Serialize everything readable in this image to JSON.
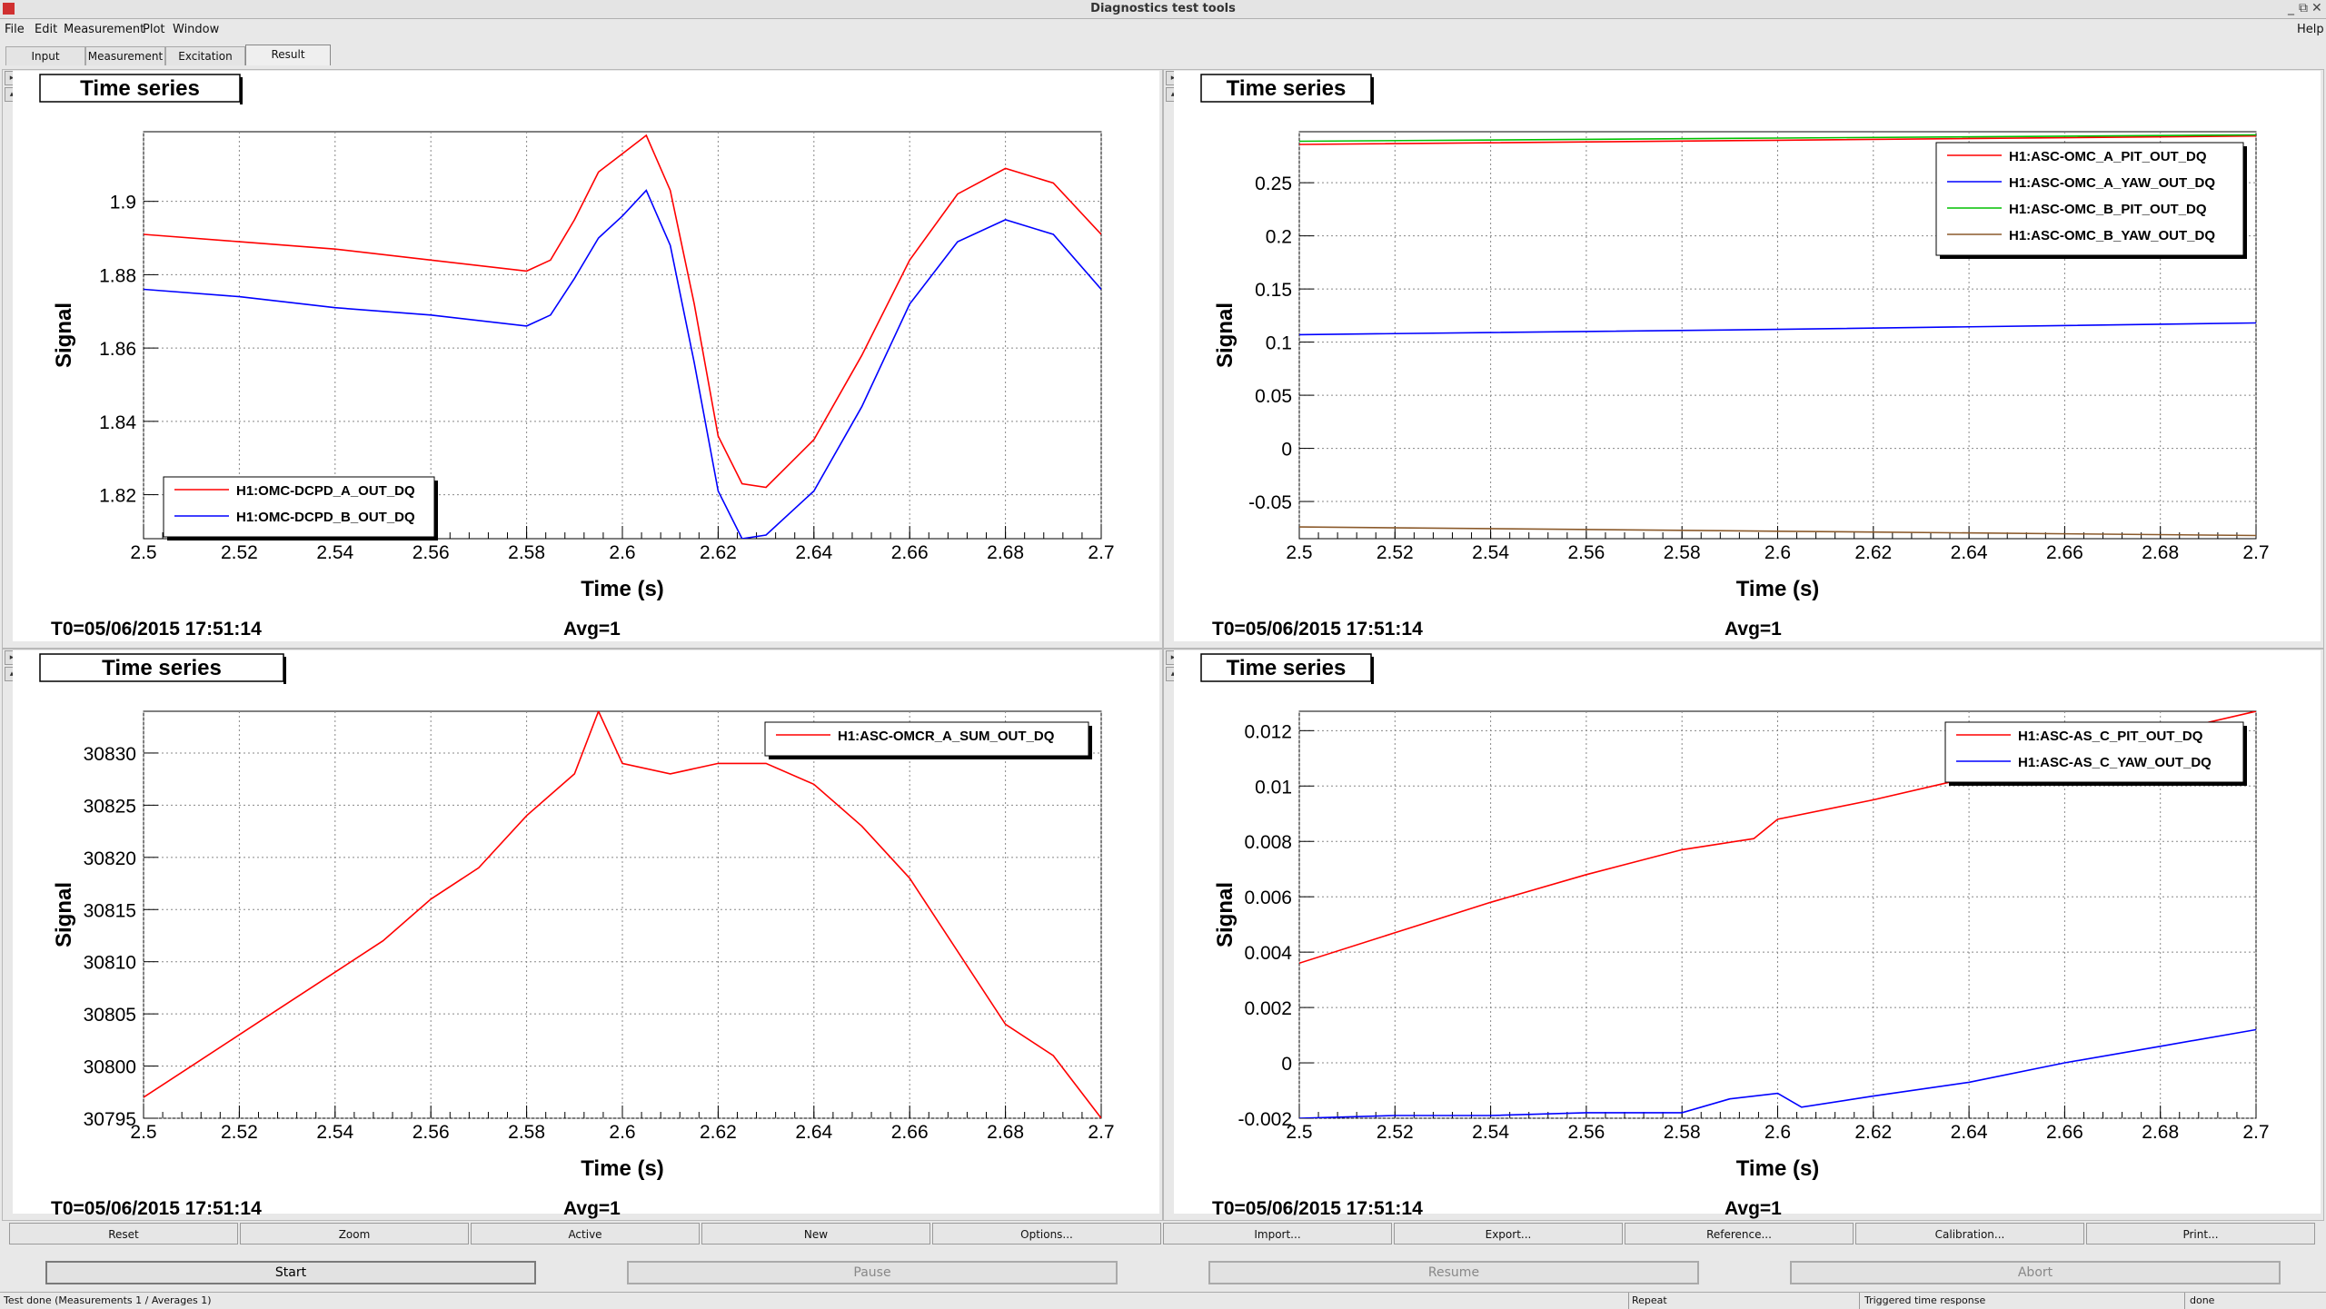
{
  "window": {
    "title": "Diagnostics test tools"
  },
  "menu": [
    "File",
    "Edit",
    "Measurement",
    "Plot",
    "Window"
  ],
  "menu_help": "Help",
  "tabs": [
    "Input",
    "Measurement",
    "Excitation",
    "Result"
  ],
  "active_tab": "Result",
  "graph_buttons": [
    "Reset",
    "Zoom",
    "Active",
    "New",
    "Options...",
    "Import...",
    "Export...",
    "Reference...",
    "Calibration...",
    "Print..."
  ],
  "action_buttons": {
    "start": "Start",
    "pause": "Pause",
    "resume": "Resume",
    "abort": "Abort"
  },
  "status": {
    "left": "Test done (Measurements 1 / Averages 1)",
    "repeat": "Repeat",
    "mode": "Triggered time response",
    "state": "done"
  },
  "chart_data": [
    {
      "type": "line",
      "title": "Time series",
      "xlabel": "Time (s)",
      "ylabel": "Signal",
      "xlim": [
        2.5,
        2.7
      ],
      "ylim": [
        1.808,
        1.919
      ],
      "xticks": [
        "2.5",
        "2.52",
        "2.54",
        "2.56",
        "2.58",
        "2.6",
        "2.62",
        "2.64",
        "2.66",
        "2.68",
        "2.7"
      ],
      "yticks": [
        "1.82",
        "1.84",
        "1.86",
        "1.88",
        "1.9"
      ],
      "ytick_values": [
        1.82,
        1.84,
        1.86,
        1.88,
        1.9
      ],
      "grid": true,
      "legend": "bottom-left",
      "footer": {
        "t0": "T0=05/06/2015 17:51:14",
        "avg": "Avg=1"
      },
      "series": [
        {
          "name": "H1:OMC-DCPD_A_OUT_DQ",
          "color": "#ff0000",
          "x": [
            2.5,
            2.52,
            2.54,
            2.56,
            2.58,
            2.585,
            2.59,
            2.595,
            2.6,
            2.605,
            2.61,
            2.615,
            2.62,
            2.625,
            2.63,
            2.64,
            2.65,
            2.66,
            2.67,
            2.68,
            2.69,
            2.7
          ],
          "y": [
            1.891,
            1.889,
            1.887,
            1.884,
            1.881,
            1.884,
            1.895,
            1.908,
            1.913,
            1.918,
            1.903,
            1.872,
            1.836,
            1.823,
            1.822,
            1.835,
            1.858,
            1.884,
            1.902,
            1.909,
            1.905,
            1.891
          ]
        },
        {
          "name": "H1:OMC-DCPD_B_OUT_DQ",
          "color": "#0000ff",
          "x": [
            2.5,
            2.52,
            2.54,
            2.56,
            2.58,
            2.585,
            2.59,
            2.595,
            2.6,
            2.605,
            2.61,
            2.615,
            2.62,
            2.625,
            2.63,
            2.64,
            2.65,
            2.66,
            2.67,
            2.68,
            2.69,
            2.7
          ],
          "y": [
            1.876,
            1.874,
            1.871,
            1.869,
            1.866,
            1.869,
            1.879,
            1.89,
            1.896,
            1.903,
            1.888,
            1.856,
            1.821,
            1.808,
            1.809,
            1.821,
            1.844,
            1.872,
            1.889,
            1.895,
            1.891,
            1.876
          ]
        }
      ]
    },
    {
      "type": "line",
      "title": "Time series",
      "xlabel": "Time (s)",
      "ylabel": "Signal",
      "xlim": [
        2.5,
        2.7
      ],
      "ylim": [
        -0.085,
        0.298
      ],
      "xticks": [
        "2.5",
        "2.52",
        "2.54",
        "2.56",
        "2.58",
        "2.6",
        "2.62",
        "2.64",
        "2.66",
        "2.68",
        "2.7"
      ],
      "yticks": [
        "-0.05",
        "0",
        "0.05",
        "0.1",
        "0.15",
        "0.2",
        "0.25"
      ],
      "ytick_values": [
        -0.05,
        0,
        0.05,
        0.1,
        0.15,
        0.2,
        0.25
      ],
      "grid": true,
      "legend": "top-right",
      "footer": {
        "t0": "T0=05/06/2015 17:51:14",
        "avg": "Avg=1"
      },
      "series": [
        {
          "name": "H1:ASC-OMC_A_PIT_OUT_DQ",
          "color": "#ff0000",
          "x": [
            2.5,
            2.6,
            2.7
          ],
          "y": [
            0.286,
            0.29,
            0.294
          ]
        },
        {
          "name": "H1:ASC-OMC_A_YAW_OUT_DQ",
          "color": "#0000ff",
          "x": [
            2.5,
            2.6,
            2.7
          ],
          "y": [
            0.107,
            0.112,
            0.118
          ]
        },
        {
          "name": "H1:ASC-OMC_B_PIT_OUT_DQ",
          "color": "#00c000",
          "x": [
            2.5,
            2.6,
            2.7
          ],
          "y": [
            0.289,
            0.292,
            0.295
          ]
        },
        {
          "name": "H1:ASC-OMC_B_YAW_OUT_DQ",
          "color": "#8b5a2b",
          "x": [
            2.5,
            2.6,
            2.7
          ],
          "y": [
            -0.074,
            -0.078,
            -0.082
          ]
        }
      ]
    },
    {
      "type": "line",
      "title": "Time series",
      "xlabel": "Time (s)",
      "ylabel": "Signal",
      "xlim": [
        2.5,
        2.7
      ],
      "ylim": [
        30795,
        30834
      ],
      "xticks": [
        "2.5",
        "2.52",
        "2.54",
        "2.56",
        "2.58",
        "2.6",
        "2.62",
        "2.64",
        "2.66",
        "2.68",
        "2.7"
      ],
      "yticks": [
        "30795",
        "30800",
        "30805",
        "30810",
        "30815",
        "30820",
        "30825",
        "30830"
      ],
      "ytick_values": [
        30795,
        30800,
        30805,
        30810,
        30815,
        30820,
        30825,
        30830
      ],
      "grid": true,
      "legend": "top-right",
      "footer": {
        "t0": "T0=05/06/2015 17:51:14",
        "avg": "Avg=1"
      },
      "series": [
        {
          "name": "H1:ASC-OMCR_A_SUM_OUT_DQ",
          "color": "#ff0000",
          "x": [
            2.5,
            2.51,
            2.52,
            2.53,
            2.54,
            2.55,
            2.56,
            2.57,
            2.58,
            2.59,
            2.595,
            2.6,
            2.61,
            2.62,
            2.63,
            2.64,
            2.65,
            2.66,
            2.67,
            2.68,
            2.69,
            2.7
          ],
          "y": [
            30797,
            30800,
            30803,
            30806,
            30809,
            30812,
            30816,
            30819,
            30824,
            30828,
            30834,
            30829,
            30828,
            30829,
            30829,
            30827,
            30823,
            30818,
            30811,
            30804,
            30801,
            30795
          ]
        }
      ]
    },
    {
      "type": "line",
      "title": "Time series",
      "xlabel": "Time (s)",
      "ylabel": "Signal",
      "xlim": [
        2.5,
        2.7
      ],
      "ylim": [
        -0.002,
        0.0127
      ],
      "xticks": [
        "2.5",
        "2.52",
        "2.54",
        "2.56",
        "2.58",
        "2.6",
        "2.62",
        "2.64",
        "2.66",
        "2.68",
        "2.7"
      ],
      "yticks": [
        "-0.002",
        "0",
        "0.002",
        "0.004",
        "0.006",
        "0.008",
        "0.01",
        "0.012"
      ],
      "ytick_values": [
        -0.002,
        0,
        0.002,
        0.004,
        0.006,
        0.008,
        0.01,
        0.012
      ],
      "grid": true,
      "legend": "top-right",
      "footer": {
        "t0": "T0=05/06/2015 17:51:14",
        "avg": "Avg=1"
      },
      "series": [
        {
          "name": "H1:ASC-AS_C_PIT_OUT_DQ",
          "color": "#ff0000",
          "x": [
            2.5,
            2.52,
            2.54,
            2.56,
            2.58,
            2.595,
            2.6,
            2.62,
            2.64,
            2.66,
            2.68,
            2.7
          ],
          "y": [
            0.0036,
            0.0047,
            0.0058,
            0.0068,
            0.0077,
            0.0081,
            0.0088,
            0.0095,
            0.0103,
            0.0111,
            0.0119,
            0.0127
          ]
        },
        {
          "name": "H1:ASC-AS_C_YAW_OUT_DQ",
          "color": "#0000ff",
          "x": [
            2.5,
            2.52,
            2.54,
            2.56,
            2.58,
            2.59,
            2.6,
            2.605,
            2.62,
            2.64,
            2.66,
            2.68,
            2.7
          ],
          "y": [
            -0.002,
            -0.0019,
            -0.0019,
            -0.0018,
            -0.0018,
            -0.0013,
            -0.0011,
            -0.0016,
            -0.0012,
            -0.0007,
            0.0,
            0.0006,
            0.0012
          ]
        }
      ]
    }
  ]
}
